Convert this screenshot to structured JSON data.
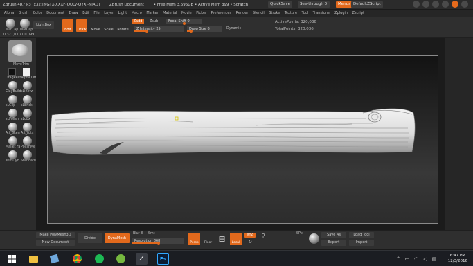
{
  "titlebar": {
    "app": "ZBrush 4R7 P3 (x32)[NGTX-XXXF-QULV-QYXI-NIAD]",
    "doc": "ZBrush Document",
    "mem": "• Free Mem 3.696GB • Active Mem 399 • Scratch",
    "quicksave": "QuickSave",
    "seethrough": "See-through 0",
    "menus": "Menus",
    "script": "DefaultZScript"
  },
  "menubar": [
    "Alpha",
    "Brush",
    "Color",
    "Document",
    "Draw",
    "Edit",
    "File",
    "Layer",
    "Light",
    "Macro",
    "Marker",
    "Material",
    "Movie",
    "Picker",
    "Preferences",
    "Render",
    "Stencil",
    "Stroke",
    "Texture",
    "Tool",
    "Transform",
    "Zplugin",
    "Zscript"
  ],
  "shelf": {
    "matcap1": "MatCap",
    "matcap2": "MatCap",
    "lightbox": "LightBox",
    "coords": "0.321,0.071,0.099",
    "edit": "Edit",
    "draw": "Draw",
    "move": "Move",
    "scale": "Scale",
    "rotate": "Rotate",
    "zadd": "Zadd",
    "zsub": "Zsub",
    "focal_shift": "Focal Shift 0",
    "z_intensity": "Z Intensity 25",
    "draw_size": "Draw Size 6",
    "dynamic": "Dynamic",
    "active_points": "ActivePoints: 320,036",
    "total_points": "TotalPoints: 320,036"
  },
  "lefttray": {
    "brush_label": "MoveTrim",
    "strokes": [
      "DragRect",
      "Alpha Off"
    ],
    "brushes": [
      "ClayBuild",
      "sLinetw",
      "sLClip",
      "sLEnck",
      "sLPolish",
      "sLcdx",
      "A.t_Sken",
      "A.t_rdts",
      "Mallet Fa",
      "PolishMe",
      "TrimDyn",
      "Standard"
    ]
  },
  "bottom": {
    "make_polymesh": "Make PolyMesh3D",
    "new_document": "New Document",
    "divide": "Divide",
    "dynamesh": "DynaMesh",
    "blur": "Blur 8",
    "smt": "Smt",
    "resolution": "Resolution 868",
    "persp": "Persp",
    "floor": "Floor",
    "local": "Local",
    "sym": "Sym",
    "xyz": "XYZ",
    "zoom": "Zoom",
    "spix": "SPix",
    "save_as": "Save As",
    "export": "Export",
    "load_tool": "Load Tool",
    "import": "Import"
  },
  "taskbar": {
    "time": "6:47 PM",
    "date": "12/3/2016"
  },
  "colors": {
    "accent": "#e2691c",
    "panel": "#2f2f2f",
    "canvas": "#1b1b1b"
  }
}
